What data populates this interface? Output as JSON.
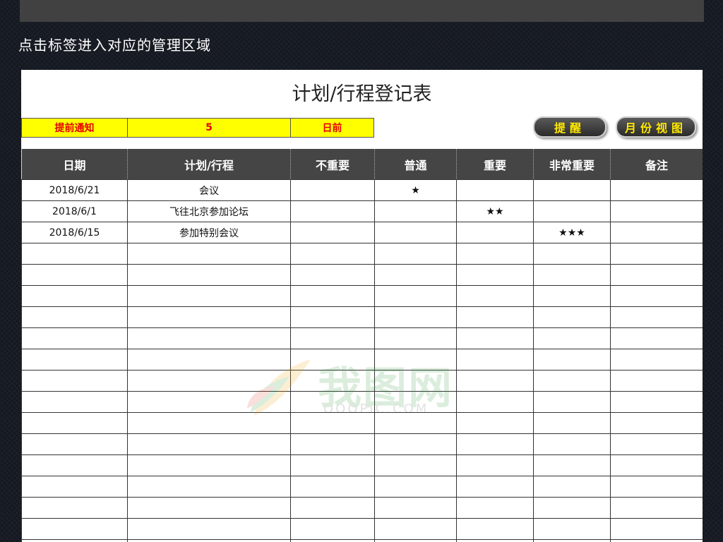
{
  "hint": "点击标签进入对应的管理区域",
  "title": "计划/行程登记表",
  "notice": {
    "label": "提前通知",
    "days": "5",
    "unit": "日前"
  },
  "buttons": {
    "remind": "提醒",
    "month_view": "月份视图"
  },
  "columns": [
    "日期",
    "计划/行程",
    "不重要",
    "普通",
    "重要",
    "非常重要",
    "备注"
  ],
  "rows": [
    [
      "2018/6/21",
      "会议",
      "",
      "★",
      "",
      "",
      ""
    ],
    [
      "2018/6/1",
      "飞往北京参加论坛",
      "",
      "",
      "★★",
      "",
      ""
    ],
    [
      "2018/6/15",
      "参加特别会议",
      "",
      "",
      "",
      "★★★",
      ""
    ],
    [
      "",
      "",
      "",
      "",
      "",
      "",
      ""
    ],
    [
      "",
      "",
      "",
      "",
      "",
      "",
      ""
    ],
    [
      "",
      "",
      "",
      "",
      "",
      "",
      ""
    ],
    [
      "",
      "",
      "",
      "",
      "",
      "",
      ""
    ],
    [
      "",
      "",
      "",
      "",
      "",
      "",
      ""
    ],
    [
      "",
      "",
      "",
      "",
      "",
      "",
      ""
    ],
    [
      "",
      "",
      "",
      "",
      "",
      "",
      ""
    ],
    [
      "",
      "",
      "",
      "",
      "",
      "",
      ""
    ],
    [
      "",
      "",
      "",
      "",
      "",
      "",
      ""
    ],
    [
      "",
      "",
      "",
      "",
      "",
      "",
      ""
    ],
    [
      "",
      "",
      "",
      "",
      "",
      "",
      ""
    ],
    [
      "",
      "",
      "",
      "",
      "",
      "",
      ""
    ],
    [
      "",
      "",
      "",
      "",
      "",
      "",
      ""
    ],
    [
      "",
      "",
      "",
      "",
      "",
      "",
      ""
    ],
    [
      "",
      "",
      "",
      "",
      "",
      "",
      ""
    ]
  ],
  "watermark": {
    "logo": "我图网",
    "url": "OOOPIC.COM"
  },
  "colors": {
    "notice_bg": "#ffff00",
    "notice_text": "#e60000",
    "header_bg": "#454545",
    "button_text": "#ffe800"
  }
}
